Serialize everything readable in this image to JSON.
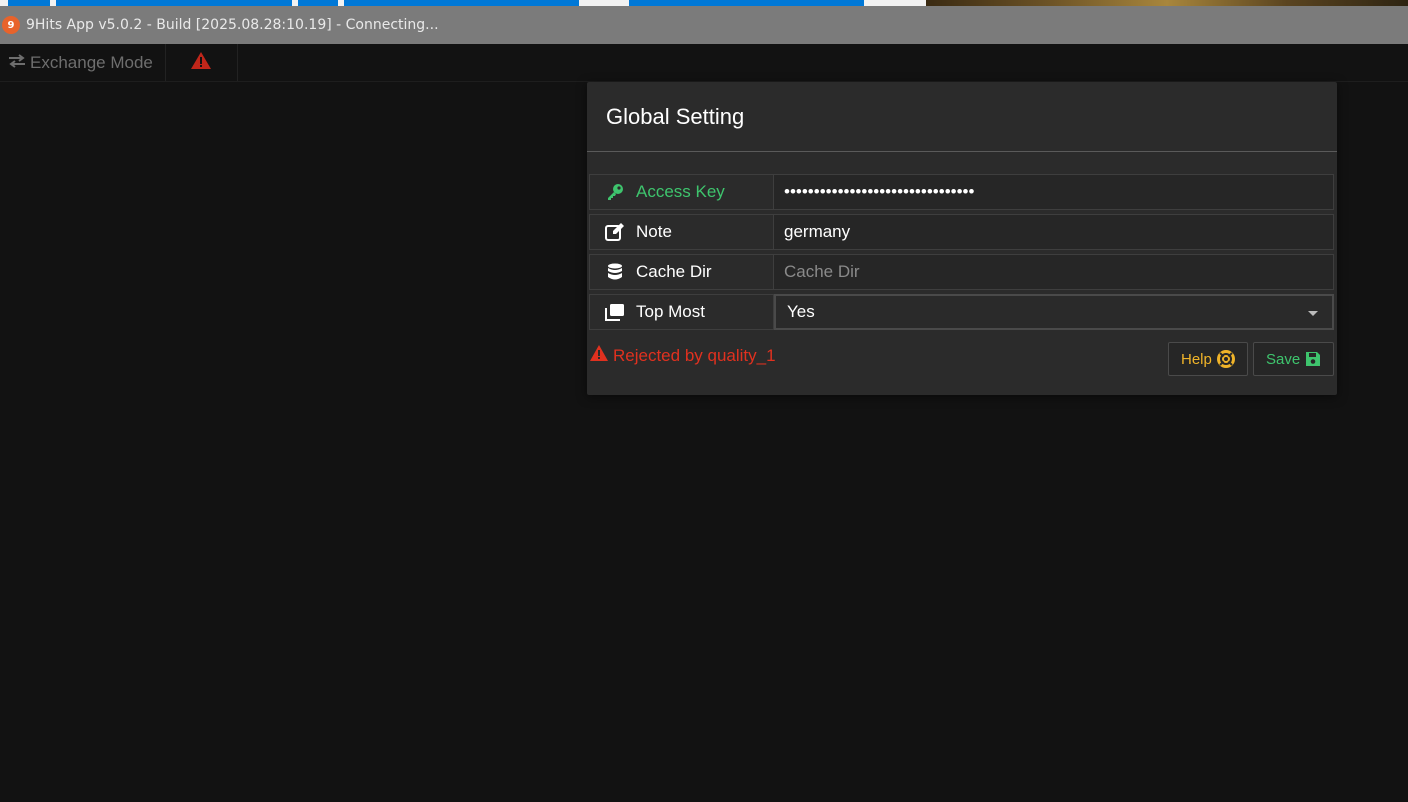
{
  "window": {
    "title": "9Hits App v5.0.2 - Build [2025.08.28:10.19] - Connecting..."
  },
  "toolbar": {
    "mode_label": "Exchange Mode",
    "mode_icon": "exchange-icon",
    "warning_icon": "warning-icon"
  },
  "dialog": {
    "title": "Global Setting",
    "fields": [
      {
        "label": "Access Key",
        "icon": "key-icon",
        "value": "••••••••••••••••••••••••••••••••",
        "type": "password"
      },
      {
        "label": "Note",
        "icon": "edit-icon",
        "value": "germany",
        "type": "text"
      },
      {
        "label": "Cache Dir",
        "icon": "database-icon",
        "value": "",
        "placeholder": "Cache Dir",
        "type": "text"
      },
      {
        "label": "Top Most",
        "icon": "window-restore-icon",
        "value": "Yes",
        "type": "select"
      }
    ],
    "error_text": "Rejected by quality_1",
    "help_label": "Help",
    "save_label": "Save"
  },
  "colors": {
    "accent_green": "#3ec46d",
    "warning_red": "#e0311f",
    "help_yellow": "#f0b429",
    "background": "#121212",
    "titlebar": "#7b7b7b"
  }
}
